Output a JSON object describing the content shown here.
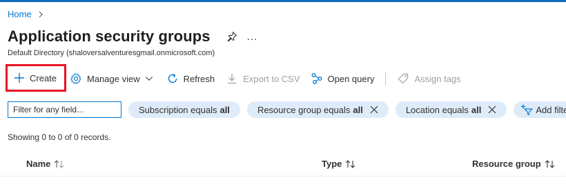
{
  "breadcrumb": {
    "home": "Home"
  },
  "page": {
    "title": "Application security groups",
    "subtitle": "Default Directory (shaloversalventuresgmail.onmicrosoft.com)",
    "more": "..."
  },
  "toolbar": {
    "create": "Create",
    "manage_view": "Manage view",
    "refresh": "Refresh",
    "export": "Export to CSV",
    "open_query": "Open query",
    "assign_tags": "Assign tags"
  },
  "filters": {
    "placeholder": "Filter for any field...",
    "subscription": {
      "label": "Subscription equals",
      "value": "all"
    },
    "resource_group": {
      "label": "Resource group equals",
      "value": "all"
    },
    "location": {
      "label": "Location equals",
      "value": "all"
    },
    "add_filter": "Add filter"
  },
  "records": "Showing 0 to 0 of 0 records.",
  "table": {
    "columns": [
      "Name",
      "Type",
      "Resource group"
    ]
  },
  "colors": {
    "accent": "#0078d4",
    "highlight_box": "#e81123",
    "pill_bg": "#deecf9"
  }
}
